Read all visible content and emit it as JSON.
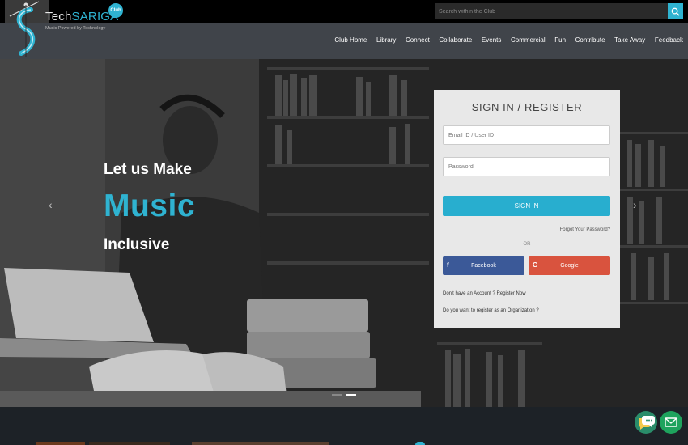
{
  "search": {
    "placeholder": "Search within the Club"
  },
  "brand": {
    "name_prefix": "Tech",
    "name_highlight": "SARIGA",
    "badge": "Club",
    "tagline": "Music Powered by Technology"
  },
  "nav": {
    "items": [
      {
        "label": "Club Home"
      },
      {
        "label": "Library"
      },
      {
        "label": "Connect"
      },
      {
        "label": "Collaborate"
      },
      {
        "label": "Events"
      },
      {
        "label": "Commercial"
      },
      {
        "label": "Fun"
      },
      {
        "label": "Contribute"
      },
      {
        "label": "Take Away"
      },
      {
        "label": "Feedback"
      }
    ]
  },
  "hero": {
    "line1": "Let us Make",
    "line2": "Music",
    "line3": "Inclusive",
    "prev_icon": "chevron-left-icon",
    "next_icon": "chevron-right-icon",
    "prev_glyph": "‹",
    "next_glyph": "›"
  },
  "signin": {
    "title": "SIGN IN / REGISTER",
    "email_placeholder": "Email ID / User ID",
    "password_placeholder": "Password",
    "button": "SIGN IN",
    "forgot": "Forgot Your Password?",
    "or": "- OR -",
    "facebook": "Facebook",
    "facebook_icon": "f",
    "google": "Google",
    "google_icon": "G",
    "register": "Don't have an Account ? Register Now",
    "organization": "Do you want to register as an Organization ?"
  },
  "colors": {
    "accent": "#2fb3d1",
    "facebook": "#3b5998",
    "google": "#d9533e",
    "whatsapp": "#1ea35d"
  }
}
